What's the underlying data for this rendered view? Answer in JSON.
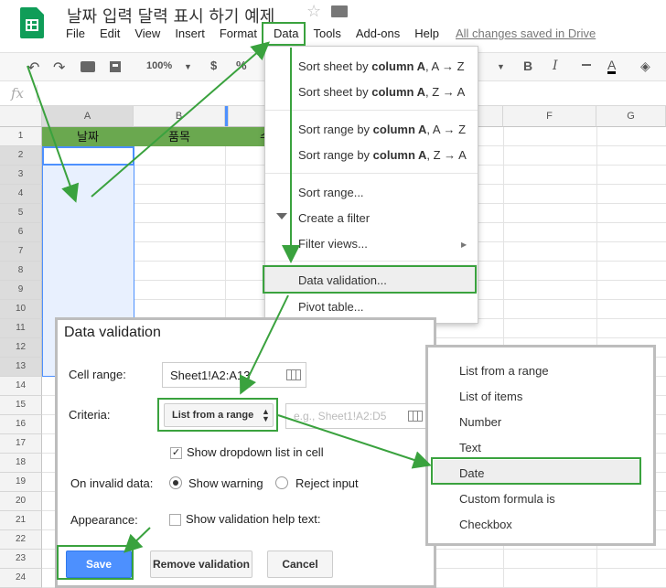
{
  "app": {
    "document_title": "날짜 입력 달력 표시 하기 예제",
    "saved_status": "All changes saved in Drive"
  },
  "menubar": [
    "File",
    "Edit",
    "View",
    "Insert",
    "Format",
    "Data",
    "Tools",
    "Add-ons",
    "Help"
  ],
  "toolbar": {
    "zoom": "100%",
    "currency": "$",
    "percent": "%",
    "bold": "B",
    "italic": "I",
    "font_color": "A"
  },
  "formula_bar": {
    "fx": "fx"
  },
  "sheet": {
    "columns": [
      "A",
      "B",
      "F",
      "G"
    ],
    "header_row": {
      "A": "날짜",
      "B": "품목",
      "C": "수"
    },
    "rows": [
      "1",
      "2",
      "3",
      "4",
      "5",
      "6",
      "7",
      "8",
      "9",
      "10",
      "11",
      "12",
      "13",
      "14",
      "15",
      "16",
      "17",
      "18",
      "19",
      "20",
      "21",
      "22",
      "23",
      "24"
    ]
  },
  "data_menu": {
    "sort_sheet_az": {
      "pre": "Sort sheet by ",
      "bold": "column A",
      "post": ", A → Z"
    },
    "sort_sheet_za": {
      "pre": "Sort sheet by ",
      "bold": "column A",
      "post": ", Z → A"
    },
    "sort_range_az": {
      "pre": "Sort range by ",
      "bold": "column A",
      "post": ", A → Z"
    },
    "sort_range_za": {
      "pre": "Sort range by ",
      "bold": "column A",
      "post": ", Z → A"
    },
    "sort_range": "Sort range...",
    "create_filter": "Create a filter",
    "filter_views": "Filter views...",
    "data_validation": "Data validation...",
    "pivot_table": "Pivot table..."
  },
  "dialog": {
    "title": "Data validation",
    "cell_range_label": "Cell range:",
    "cell_range_value": "Sheet1!A2:A13",
    "criteria_label": "Criteria:",
    "criteria_value": "List from a range",
    "criteria_placeholder": "e.g., Sheet1!A2:D5",
    "show_dropdown": "Show dropdown list in cell",
    "invalid_label": "On invalid data:",
    "show_warning": "Show warning",
    "reject_input": "Reject input",
    "appearance_label": "Appearance:",
    "help_text": "Show validation help text:",
    "save": "Save",
    "remove": "Remove validation",
    "cancel": "Cancel"
  },
  "criteria_options": [
    "List from a range",
    "List of items",
    "Number",
    "Text",
    "Date",
    "Custom formula is",
    "Checkbox"
  ],
  "colors": {
    "accent_green": "#3aa23e",
    "header_fill": "#6aa84f",
    "save_blue": "#4d90fe"
  }
}
